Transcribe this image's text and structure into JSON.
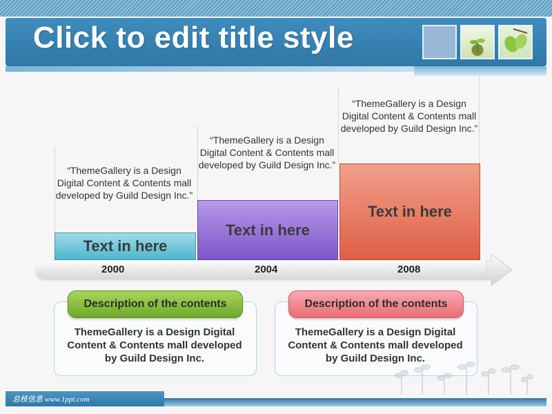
{
  "header": {
    "title": "Click to edit title style"
  },
  "timeline": {
    "years": [
      "2000",
      "2004",
      "2008"
    ],
    "blocks": [
      {
        "label": "Text in here",
        "quote": "“ThemeGallery is a Design Digital Content & Contents mall developed by Guild Design Inc.”"
      },
      {
        "label": "Text in here",
        "quote": "“ThemeGallery is a Design Digital Content & Contents mall developed by Guild Design Inc.”"
      },
      {
        "label": "Text in here",
        "quote": "“ThemeGallery is a Design Digital Content & Contents mall developed by Guild Design Inc.”"
      }
    ]
  },
  "descriptions": [
    {
      "title": "Description  of the contents",
      "body": "ThemeGallery is a Design Digital Content & Contents mall developed by Guild Design Inc."
    },
    {
      "title": "Description  of the contents",
      "body": "ThemeGallery is a Design Digital Content & Contents mall developed by Guild Design Inc."
    }
  ],
  "footer": {
    "text": "总枝信息  www.1ppt.com"
  },
  "colors": {
    "header_blue": "#2f78a8",
    "block_cyan": "#4fb6cd",
    "block_purple": "#7d55c9",
    "block_orange": "#de5f46",
    "pill_green": "#6fa82a",
    "pill_red": "#ea6b74"
  },
  "icons": [
    "photo-thumbnail-blank",
    "sprout-photo-icon",
    "leaf-photo-icon",
    "timeline-arrow-icon",
    "sprouts-decoration-icon"
  ]
}
